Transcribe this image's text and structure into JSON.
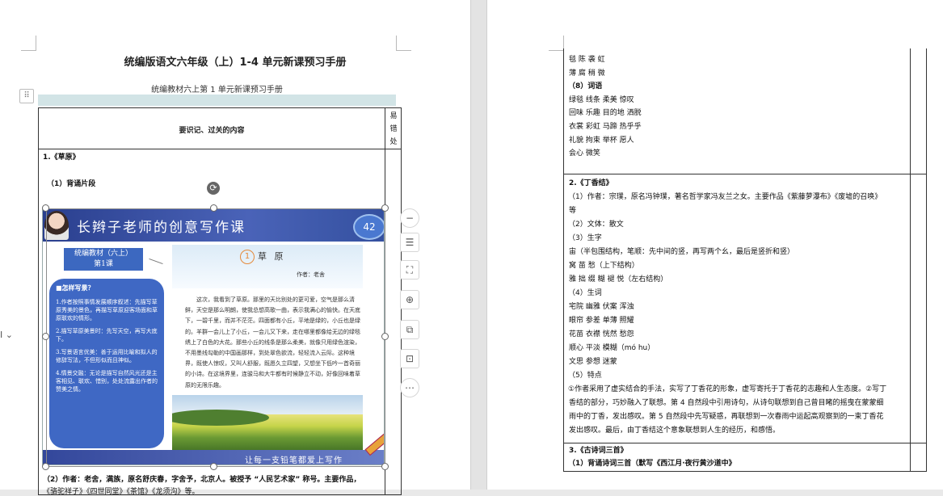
{
  "left_page": {
    "title": "统编版语文六年级（上）1-4 单元新课预习手册",
    "subtitle": "统编教材六上第 1 单元新课预习手册",
    "table": {
      "header": "要识记、过关的内容",
      "side_header": [
        "易",
        "错",
        "处"
      ],
      "section1": "1.《草原》",
      "sub1": "（1）背诵片段",
      "bottom_line1": "（2）作者：老舍，满族，原名舒庆春，字舍予，北京人。被授予 “人民艺术家” 称号。主要作品，",
      "bottom_line2": "《骆驼祥子》《四世同堂》《茶馆》《龙须沟》等。"
    },
    "image": {
      "banner_title": "长辫子老师的创意写作课",
      "page_number": "42",
      "lesson_line1": "统编教材（六上）",
      "lesson_line2": "第1课",
      "tips_heading": "■怎样写景？",
      "tip1": "1.作者按照事情发展顺序叙述：先描写草原秀美的景色，再描写草原迎客场面和草原联欢的情形。",
      "tip2": "2.描写草原美景时：先写天空，再写大底下。",
      "tip3": "3.写景语言优美：善于运用比喻和拟人的修辞写法，不但形似而且神似。",
      "tip4": "4.情景交融：无论是描写自然风光还是主客相见、联欢、惜别，处处流露出作者的赞美之情。",
      "lesson_number": "1",
      "lesson_title": "草 原",
      "author": "作者：老舍",
      "body": "这次，我看到了草原。那里的天比别处的更可爱，空气是那么清鲜，天空是那么明朗，使我总想高歌一曲，表示我满心的愉快。在天底下，一碧千里，而并不茫茫。四面都有小丘，平地是绿的，小丘也是绿的。羊群一会儿上了小丘，一会儿又下来，走在哪里都像给无边的绿毯绣上了白色的大花。那些小丘的线条是那么柔美，就像只用绿色渲染，不用墨线勾勒的中国画那样，到处翠色欲流，轻轻流入云际。这种境界，既使人惊叹，又叫人舒服，既愿久立四望，又想坐下低吟一首奇丽的小诗。在这境界里，连骏马和大牛都有时候静立不动，好像回味着草原的无限乐趣。",
      "slogan": "让每一支铅笔都爱上写作"
    }
  },
  "right_page": {
    "lines_top": [
      {
        "text": "毯      陈      袭      虹",
        "bold": false
      },
      {
        "text": "薄    腐       稍        微",
        "bold": false
      },
      {
        "text": "（8）词语",
        "bold": true
      },
      {
        "text": "绿毯    线条      柔美      惊叹",
        "bold": false
      },
      {
        "text": "回味    乐趣    目的地    洒脱",
        "bold": false
      },
      {
        "text": "衣裳    彩虹    马蹄    热乎乎",
        "bold": false
      },
      {
        "text": "礼貌    拘束      举杯      愿人",
        "bold": false
      },
      {
        "text": "会心      微笑",
        "bold": false
      }
    ],
    "lines_mid": [
      {
        "text": "2.《丁香结》",
        "bold": true
      },
      {
        "text": "（1）作者：宗璞，原名冯钟璞，著名哲学家冯友兰之女。主要作品《紫藤萝瀑布》《废墟的召唤》",
        "bold": false
      },
      {
        "text": "等",
        "bold": false
      },
      {
        "text": "（2）文体：散文",
        "bold": false
      },
      {
        "text": "（3）生字",
        "bold": false
      },
      {
        "text": "宙（半包围结构，笔顺：先中间的竖，再写两个幺，最后是竖折和竖）",
        "bold": false
      },
      {
        "text": "窝    苗      愁（上下结构）",
        "bold": false
      },
      {
        "text": "雅    拙    缀      糊    褪    悦（左右结构）",
        "bold": false
      },
      {
        "text": "（4）生词",
        "bold": false
      },
      {
        "text": "宅院    幽雅    伏案    浑浊",
        "bold": false
      },
      {
        "text": "眼帘    参差    单薄        照耀",
        "bold": false
      },
      {
        "text": "花苗    衣襟    恍然    愁怨",
        "bold": false
      },
      {
        "text": "顺心    平淡    模糊（mó hu）",
        "bold": false
      },
      {
        "text": "文思    参想    迷蒙",
        "bold": false
      },
      {
        "text": "（5）特点",
        "bold": false
      },
      {
        "text": "①作者采用了虚实结合的手法，实写了丁香花的形象，虚写寄托于丁香花的志趣和人生态度。②写丁",
        "bold": false
      },
      {
        "text": "香结的部分，巧妙融入了联想。第 4 自然段中引用诗句，从诗句联想到自己曾目睹的摇曳在蒙蒙细",
        "bold": false
      },
      {
        "text": "雨中的丁香，发出感叹。第 5 自然段中先写疑惑，再联想到一次春雨中运起高观察到的一束丁香花",
        "bold": false
      },
      {
        "text": "发出感叹。最后，由丁香结这个意象联想到人生的经历，和感悟。",
        "bold": false
      }
    ],
    "lines_bottom": [
      {
        "text": "3.《古诗词三首》",
        "bold": true
      },
      {
        "text": "（1）背诵诗词三首（默写《西江月·夜行黄沙道中》",
        "bold": true
      }
    ]
  }
}
